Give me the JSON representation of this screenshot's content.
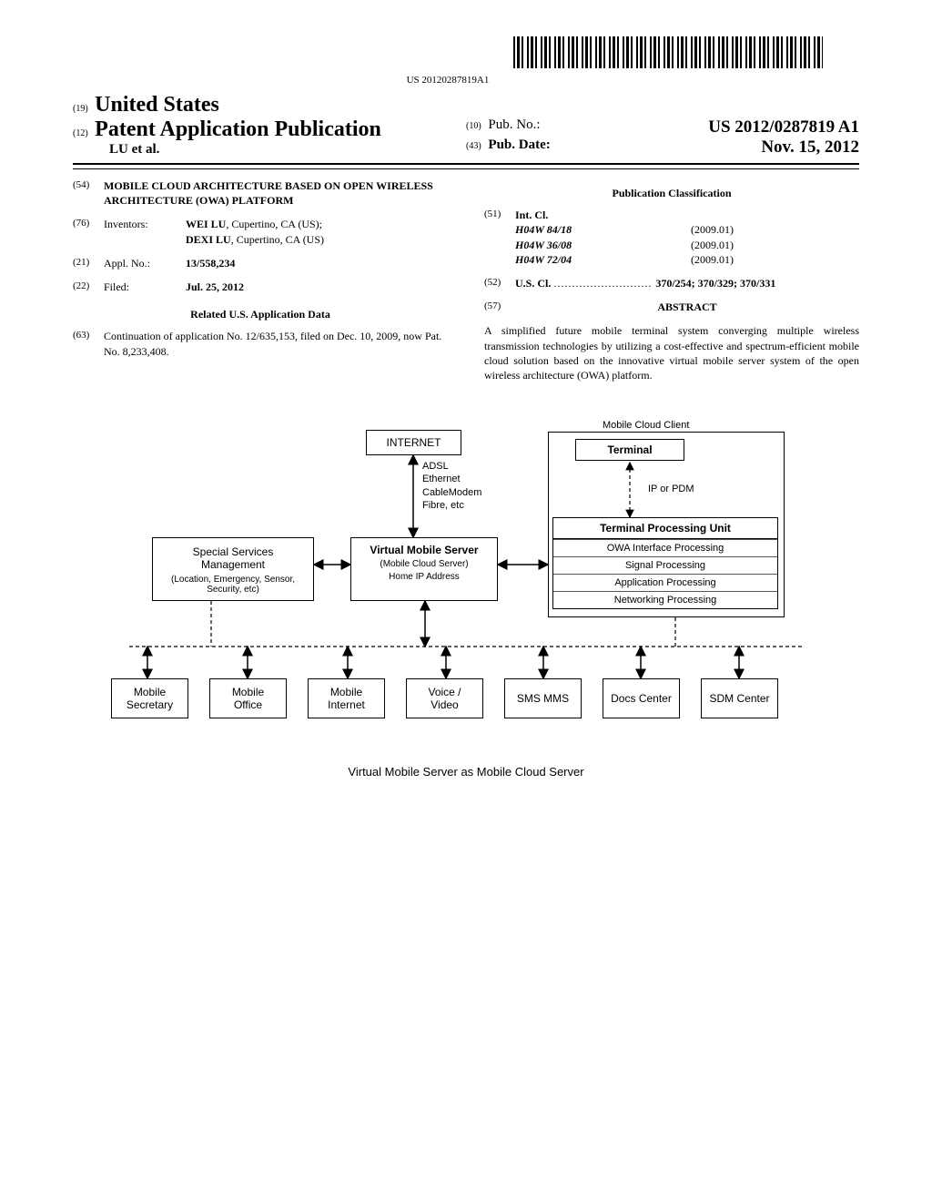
{
  "barcode_text": "US 20120287819A1",
  "header": {
    "country_code": "(19)",
    "country": "United States",
    "pub_type_code": "(12)",
    "pub_type": "Patent Application Publication",
    "authors": "LU et al.",
    "pubno_code": "(10)",
    "pubno_label": "Pub. No.:",
    "pubno_value": "US 2012/0287819 A1",
    "pubdate_code": "(43)",
    "pubdate_label": "Pub. Date:",
    "pubdate_value": "Nov. 15, 2012"
  },
  "left": {
    "title_code": "(54)",
    "title": "MOBILE CLOUD ARCHITECTURE BASED ON OPEN WIRELESS ARCHITECTURE (OWA) PLATFORM",
    "inventors_code": "(76)",
    "inventors_label": "Inventors:",
    "inventors_value": "WEI LU, Cupertino, CA (US); DEXI LU, Cupertino, CA (US)",
    "appl_code": "(21)",
    "appl_label": "Appl. No.:",
    "appl_value": "13/558,234",
    "filed_code": "(22)",
    "filed_label": "Filed:",
    "filed_value": "Jul. 25, 2012",
    "related_heading": "Related U.S. Application Data",
    "cont_code": "(63)",
    "cont_text": "Continuation of application No. 12/635,153, filed on Dec. 10, 2009, now Pat. No. 8,233,408."
  },
  "right": {
    "classification_heading": "Publication Classification",
    "intcl_code": "(51)",
    "intcl_label": "Int. Cl.",
    "intcl": [
      {
        "class": "H04W 84/18",
        "ver": "(2009.01)"
      },
      {
        "class": "H04W 36/08",
        "ver": "(2009.01)"
      },
      {
        "class": "H04W 72/04",
        "ver": "(2009.01)"
      }
    ],
    "uscl_code": "(52)",
    "uscl_label": "U.S. Cl.",
    "uscl_value": "370/254; 370/329; 370/331",
    "abstract_code": "(57)",
    "abstract_heading": "ABSTRACT",
    "abstract_text": "A simplified future mobile terminal system converging multiple wireless transmission technologies by utilizing a cost-effective and spectrum-efficient mobile cloud solution based on the innovative virtual mobile server system of the open wireless architecture (OWA) platform."
  },
  "figure": {
    "internet": "INTERNET",
    "conn_list": "ADSL\nEthernet\nCableModem\nFibre, etc",
    "mcc_label": "Mobile Cloud Client",
    "terminal": "Terminal",
    "ip_pdm": "IP  or  PDM",
    "tpu_header": "Terminal Processing Unit",
    "tpu_rows": [
      "OWA Interface Processing",
      "Signal Processing",
      "Application Processing",
      "Networking Processing"
    ],
    "ssm_title": "Special Services Management",
    "ssm_sub": "(Location, Emergency, Sensor, Security, etc)",
    "vms_title": "Virtual Mobile Server",
    "vms_sub1": "(Mobile Cloud Server)",
    "vms_sub2": "Home IP Address",
    "services": [
      "Mobile Secretary",
      "Mobile Office",
      "Mobile Internet",
      "Voice / Video",
      "SMS MMS",
      "Docs Center",
      "SDM Center"
    ],
    "caption": "Virtual Mobile Server as Mobile Cloud Server"
  }
}
